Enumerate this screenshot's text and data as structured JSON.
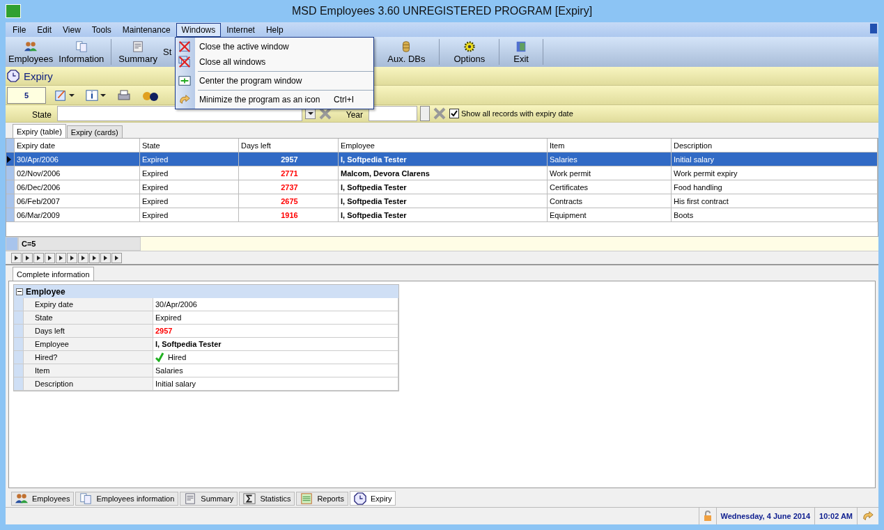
{
  "window": {
    "title": "MSD Employees 3.60 UNREGISTERED PROGRAM [Expiry]"
  },
  "menu": [
    {
      "label": "File",
      "selected": false
    },
    {
      "label": "Edit",
      "selected": false
    },
    {
      "label": "View",
      "selected": false
    },
    {
      "label": "Tools",
      "selected": false
    },
    {
      "label": "Maintenance",
      "selected": false
    },
    {
      "label": "Windows",
      "selected": true
    },
    {
      "label": "Internet",
      "selected": false
    },
    {
      "label": "Help",
      "selected": false
    }
  ],
  "open_menu": [
    {
      "label": "Close the active window",
      "kind": "close",
      "separator_before": false
    },
    {
      "label": "Close all windows",
      "kind": "close_all",
      "separator_before": false
    },
    {
      "label": "Center the program window",
      "kind": "center",
      "separator_before": true
    },
    {
      "label": "Minimize the program as an icon",
      "shortcut": "Ctrl+I",
      "kind": "minimize",
      "separator_before": true
    }
  ],
  "toolbar_left": [
    {
      "label": "Employees",
      "kind": "people"
    },
    {
      "label": "Information",
      "kind": "docs"
    },
    {
      "label": "Summary",
      "kind": "form"
    },
    {
      "label": "St",
      "kind": "none"
    }
  ],
  "toolbar_right": [
    {
      "label": "Aux. DBs",
      "kind": "db"
    },
    {
      "label": "Options",
      "kind": "gear"
    },
    {
      "label": "Exit",
      "kind": "door"
    }
  ],
  "section": {
    "title": "Expiry"
  },
  "record_count": "5",
  "filter": {
    "state_label": "State",
    "year_label": "Year",
    "show_all": {
      "label": "Show all records with expiry date",
      "checked": true
    }
  },
  "view_tabs": [
    {
      "label": "Expiry (table)",
      "selected": true
    },
    {
      "label": "Expiry (cards)",
      "selected": false
    }
  ],
  "table": {
    "columns": [
      "Expiry date",
      "State",
      "Days left",
      "Employee",
      "Item",
      "Description"
    ],
    "rows": [
      {
        "selected": true,
        "cells": [
          "30/Apr/2006",
          "Expired",
          "2957",
          "I, Softpedia Tester",
          "Salaries",
          "Initial salary"
        ]
      },
      {
        "selected": false,
        "cells": [
          "02/Nov/2006",
          "Expired",
          "2771",
          "Malcom, Devora Clarens",
          "Work permit",
          "Work permit expiry"
        ]
      },
      {
        "selected": false,
        "cells": [
          "06/Dec/2006",
          "Expired",
          "2737",
          "I, Softpedia Tester",
          "Certificates",
          "Food handling"
        ]
      },
      {
        "selected": false,
        "cells": [
          "06/Feb/2007",
          "Expired",
          "2675",
          "I, Softpedia Tester",
          "Contracts",
          "His first contract"
        ]
      },
      {
        "selected": false,
        "cells": [
          "06/Mar/2009",
          "Expired",
          "1916",
          "I, Softpedia Tester",
          "Equipment",
          "Boots"
        ]
      }
    ],
    "footer": "C=5"
  },
  "detail_tab": {
    "label": "Complete information",
    "selected": true
  },
  "details": {
    "group": "Employee",
    "expanded": true,
    "rows": [
      {
        "label": "Expiry date",
        "value": "30/Apr/2006",
        "kind": "text"
      },
      {
        "label": "State",
        "value": "Expired",
        "kind": "text"
      },
      {
        "label": "Days left",
        "value": "2957",
        "kind": "alert"
      },
      {
        "label": "Employee",
        "value": "I, Softpedia Tester",
        "kind": "bold"
      },
      {
        "label": "Hired?",
        "value": "Hired",
        "kind": "check"
      },
      {
        "label": "Item",
        "value": "Salaries",
        "kind": "text"
      },
      {
        "label": "Description",
        "value": "Initial salary",
        "kind": "text"
      }
    ]
  },
  "window_tabs": [
    {
      "label": "Employees",
      "kind": "people",
      "selected": false
    },
    {
      "label": "Employees information",
      "kind": "docs",
      "selected": false
    },
    {
      "label": "Summary",
      "kind": "form",
      "selected": false
    },
    {
      "label": "Statistics",
      "kind": "sigma",
      "selected": false
    },
    {
      "label": "Reports",
      "kind": "sheet",
      "selected": false
    },
    {
      "label": "Expiry",
      "kind": "clock",
      "selected": true
    }
  ],
  "status_bar": {
    "date": "Wednesday, 4 June 2014",
    "time": "10:02 AM"
  }
}
